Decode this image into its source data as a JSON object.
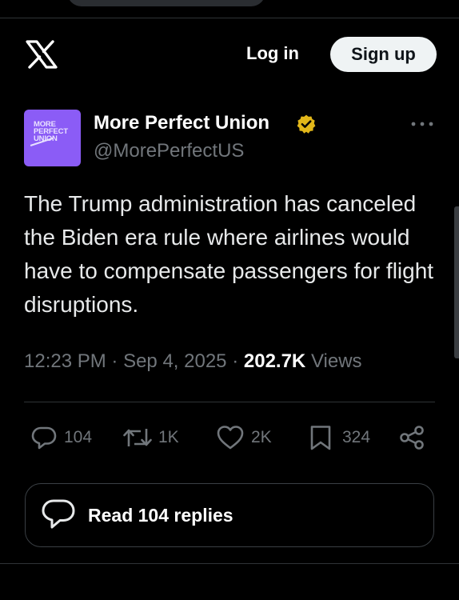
{
  "header": {
    "logo_icon": "x-logo-icon",
    "login_label": "Log in",
    "signup_label": "Sign up"
  },
  "tweet": {
    "avatar": {
      "lines": [
        "MORE",
        "PERFECT",
        "UNION"
      ],
      "bg_color": "#8b5cf6"
    },
    "author_name": "More Perfect Union",
    "verified_icon": "verified-badge-icon",
    "verified_color": "#e2b719",
    "handle": "@MorePerfectUS",
    "text": "The Trump administration has canceled the Biden era rule where airlines would have to compensate passengers for flight disruptions.",
    "time": "12:23 PM",
    "date": "Sep 4, 2025",
    "separator": "·",
    "views_count": "202.7K",
    "views_label": "Views"
  },
  "actions": {
    "replies": {
      "icon": "reply-icon",
      "count": "104"
    },
    "reposts": {
      "icon": "repost-icon",
      "count": "1K"
    },
    "likes": {
      "icon": "heart-icon",
      "count": "2K"
    },
    "bookmarks": {
      "icon": "bookmark-icon",
      "count": "324"
    },
    "share": {
      "icon": "share-icon"
    }
  },
  "read_replies": {
    "icon": "chat-bubble-icon",
    "label": "Read 104 replies"
  },
  "colors": {
    "background": "#000000",
    "text_primary": "#e7e9ea",
    "text_secondary": "#71767b",
    "border": "#2f3336"
  }
}
